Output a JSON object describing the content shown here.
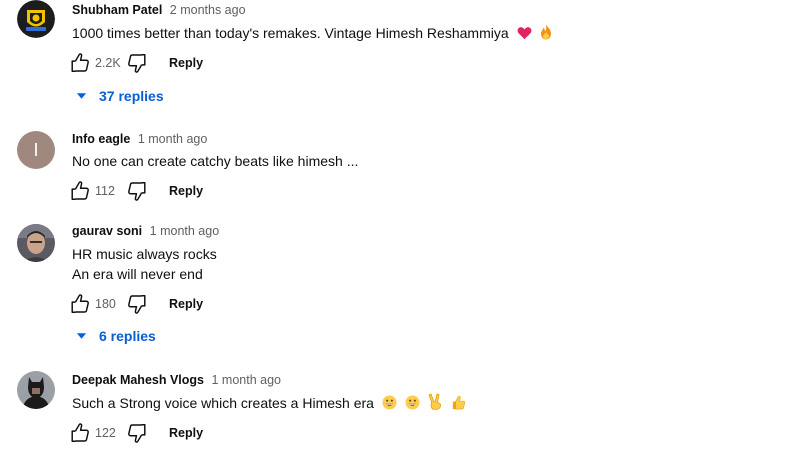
{
  "comments": [
    {
      "author": "Shubham Patel",
      "time": "2 months ago",
      "text": "1000 times better than today's remakes. Vintage Himesh Reshammiya",
      "emojis": [
        "heart",
        "fire"
      ],
      "likes": "2.2K",
      "reply_label": "Reply",
      "replies": "37 replies",
      "avatar": {
        "type": "logo",
        "colors": [
          "#1d1d1d",
          "#f2c200",
          "#2f6fd6"
        ]
      }
    },
    {
      "author": "Info eagle",
      "time": "1 month ago",
      "text": "No one can create catchy beats like himesh ...",
      "likes": "112",
      "reply_label": "Reply",
      "avatar": {
        "type": "letter",
        "letter": "I",
        "color": "#a1887f"
      }
    },
    {
      "author": "gaurav soni",
      "time": "1 month ago",
      "text_lines": [
        "HR music always rocks",
        "An era will never end"
      ],
      "likes": "180",
      "reply_label": "Reply",
      "replies": "6 replies",
      "avatar": {
        "type": "photo",
        "colors": [
          "#5b5a62",
          "#c9a48a"
        ]
      }
    },
    {
      "author": "Deepak Mahesh Vlogs",
      "time": "1 month ago",
      "text": "Such a Strong voice which creates a Himesh era",
      "emojis": [
        "grin",
        "grin",
        "victory",
        "thumbs-up"
      ],
      "likes": "122",
      "reply_label": "Reply",
      "avatar": {
        "type": "photo",
        "colors": [
          "#9aa0a6",
          "#1b1b1b"
        ]
      }
    }
  ],
  "colors": {
    "link": "#065fd4",
    "meta": "#606060",
    "text": "#0f0f0f"
  }
}
